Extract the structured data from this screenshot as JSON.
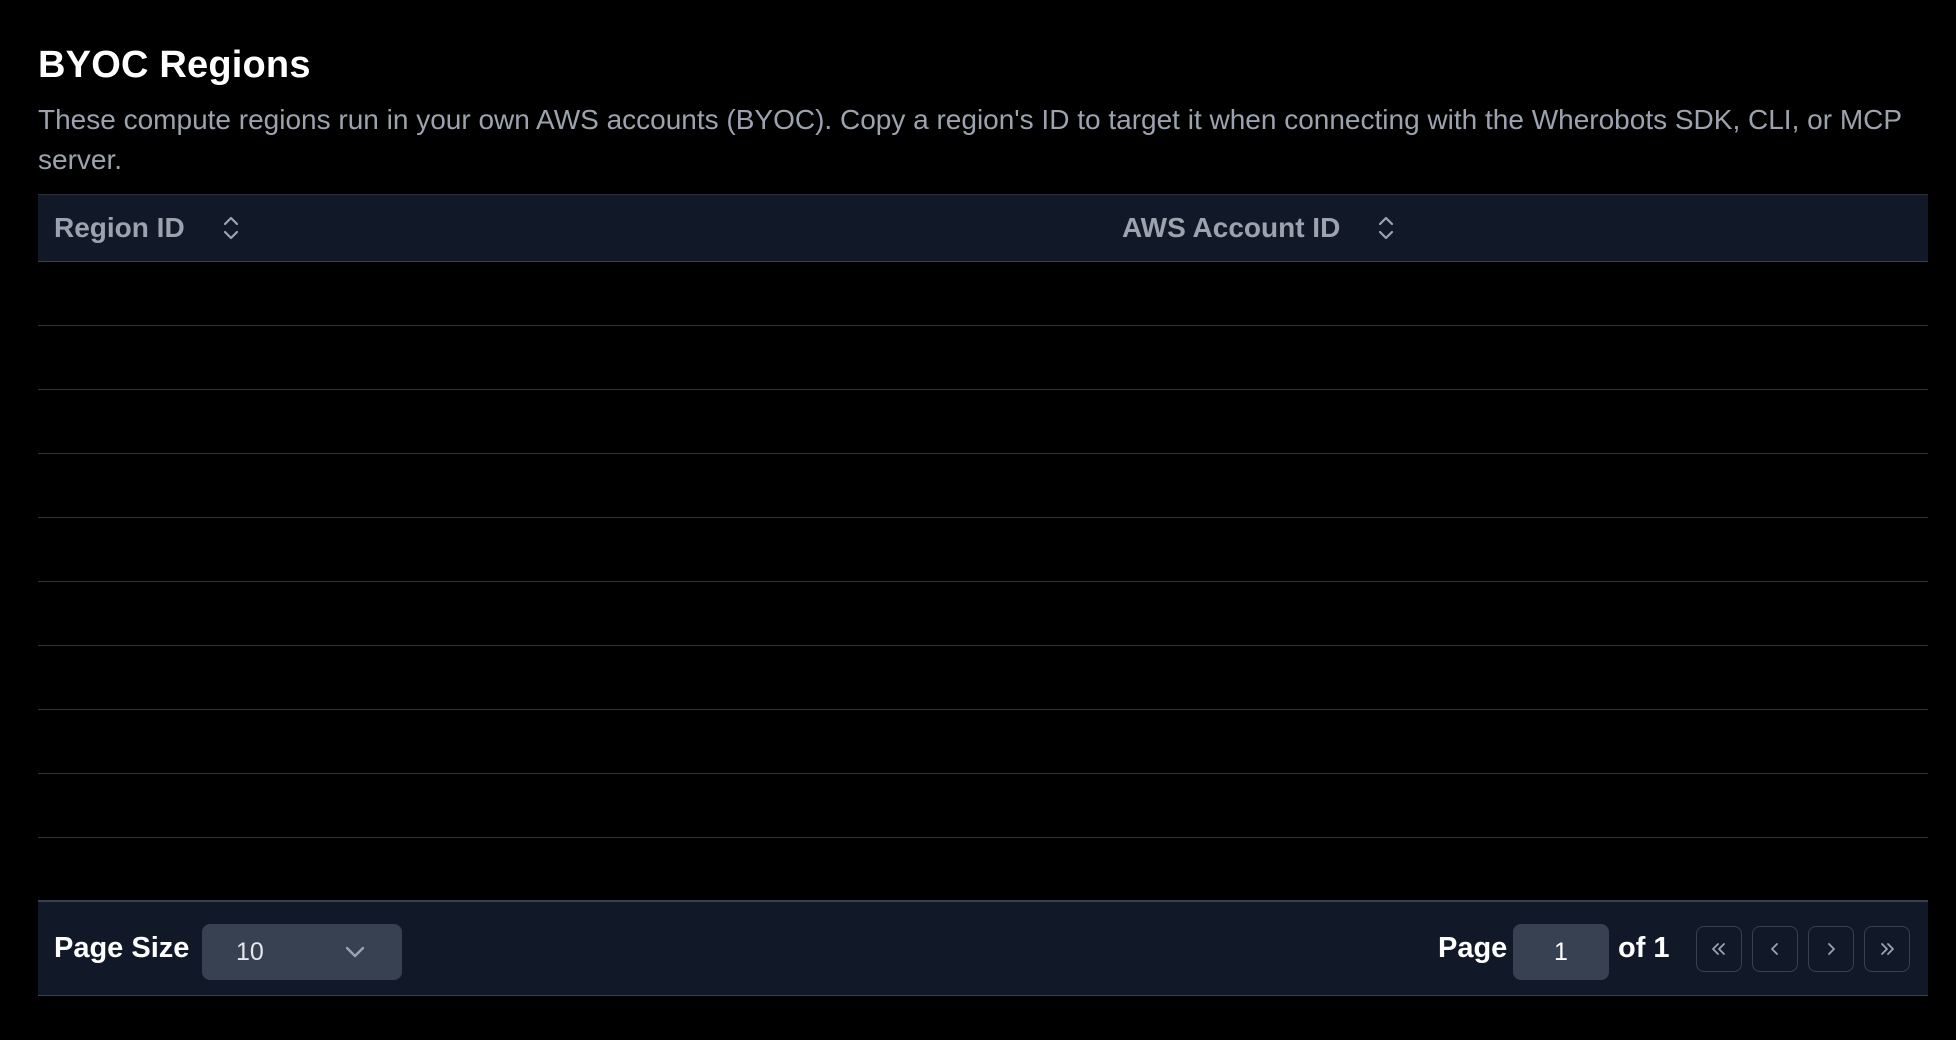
{
  "page": {
    "title": "BYOC Regions",
    "description": "These compute regions run in your own AWS accounts (BYOC). Copy a region's ID to target it when connecting with the Wherobots SDK, CLI, or MCP server."
  },
  "table": {
    "columns": [
      {
        "label": "Region ID",
        "sort_icon": "sort-updown-icon"
      },
      {
        "label": "AWS Account ID",
        "sort_icon": "sort-updown-icon"
      }
    ],
    "rows": [
      [],
      [],
      [],
      [],
      [],
      [],
      [],
      [],
      [],
      []
    ]
  },
  "pagination": {
    "page_size_label": "Page Size",
    "page_size_value": "10",
    "page_label": "Page",
    "current_page": "1",
    "of_label": "of 1",
    "buttons": [
      "first-page-icon",
      "previous-page-icon",
      "next-page-icon",
      "last-page-icon"
    ]
  },
  "colors": {
    "background": "#000000",
    "header_bg": "#111827",
    "control_bg": "#374151",
    "muted_text": "#9ca3af"
  }
}
